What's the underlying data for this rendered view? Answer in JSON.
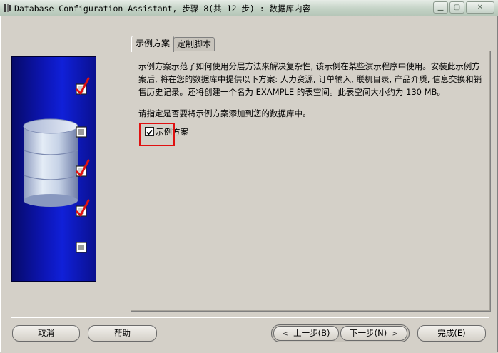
{
  "window": {
    "title": "Database Configuration Assistant, 步骤 8(共 12 步) : 数据库内容"
  },
  "tabs": [
    {
      "label": "示例方案",
      "active": true
    },
    {
      "label": "定制脚本",
      "active": false
    }
  ],
  "content": {
    "description": "示例方案示范了如何使用分层方法来解决复杂性, 该示例在某些演示程序中使用。安装此示例方案后, 将在您的数据库中提供以下方案: 人力资源, 订单输入, 联机目录, 产品介质, 信息交换和销售历史记录。还将创建一个名为 EXAMPLE 的表空间。此表空间大小约为 130 MB。",
    "prompt": "请指定是否要将示例方案添加到您的数据库中。",
    "checkbox": {
      "label": "示例方案",
      "checked": true
    }
  },
  "buttons": {
    "cancel": "取消",
    "help": "帮助",
    "back": "上一步(B)",
    "next": "下一步(N)",
    "finish": "完成(E)"
  },
  "icons": {
    "app": "java-app-icon",
    "check": "red-checkmark-icon",
    "database": "database-cylinder-icon"
  },
  "colors": {
    "side_panel": "#0d16b8",
    "check_mark": "#e01010",
    "highlight": "#e01010"
  }
}
